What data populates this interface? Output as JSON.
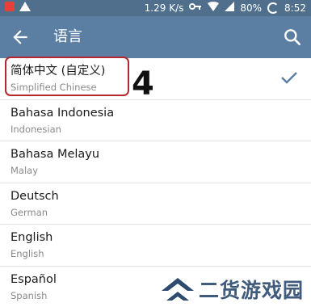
{
  "status_bar": {
    "speed": "1.29 K/s",
    "battery": "80%",
    "time": "8:52"
  },
  "app_bar": {
    "title": "语言"
  },
  "languages": [
    {
      "name": "简体中文 (自定义)",
      "subtitle": "Simplified Chinese",
      "selected": true
    },
    {
      "name": "Bahasa Indonesia",
      "subtitle": "Indonesian",
      "selected": false
    },
    {
      "name": "Bahasa Melayu",
      "subtitle": "Malay",
      "selected": false
    },
    {
      "name": "Deutsch",
      "subtitle": "German",
      "selected": false
    },
    {
      "name": "English",
      "subtitle": "English",
      "selected": false
    },
    {
      "name": "Español",
      "subtitle": "Spanish",
      "selected": false
    }
  ],
  "annotation": {
    "step": "4",
    "highlight_color": "#b3272d"
  },
  "watermark": {
    "text": "二货游戏园"
  },
  "colors": {
    "status_bar": "#4f6f8c",
    "app_bar": "#5b7fa3",
    "check": "#5b7fa3"
  }
}
